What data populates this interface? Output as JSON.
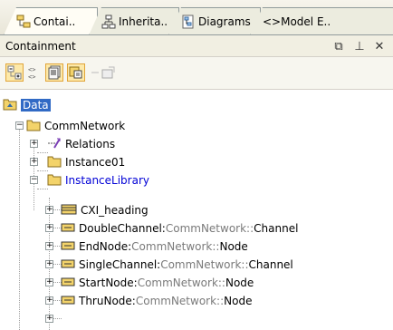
{
  "tabs": [
    {
      "label": "Contai..",
      "icon": "containment-tree-icon"
    },
    {
      "label": "Inherita..",
      "icon": "inheritance-tree-icon"
    },
    {
      "label": "Diagrams",
      "icon": "diagrams-icon"
    },
    {
      "label": "<>Model E..",
      "icon": "model-extensions-icon"
    }
  ],
  "panel": {
    "title": "Containment",
    "restore_icon": "restore-icon",
    "pin_icon": "pin-icon",
    "close_icon": "close-icon",
    "restore_glyph": "⧉",
    "pin_glyph": "⊥",
    "close_glyph": "✕"
  },
  "toolbar": {
    "buttons": [
      "collapse-all-icon",
      "expand-all-icon",
      "view-options-icon",
      "filter-icon",
      "new-element-icon"
    ]
  },
  "tree": {
    "data": {
      "label": "Data"
    },
    "comm_network": {
      "label": "CommNetwork"
    },
    "relations": {
      "label": "Relations"
    },
    "instance01": {
      "label": "Instance01"
    },
    "instance_library": {
      "label": "InstanceLibrary"
    },
    "cxi_heading": {
      "label": "CXI_heading"
    },
    "double_channel": {
      "label": "DoubleChannel",
      "sep": " : ",
      "type": "CommNetwork::",
      "type_name": "Channel"
    },
    "end_node": {
      "label": "EndNode",
      "sep": " : ",
      "type": "CommNetwork::",
      "type_name": "Node"
    },
    "single_channel": {
      "label": "SingleChannel",
      "sep": " : ",
      "type": "CommNetwork::",
      "type_name": "Channel"
    },
    "start_node": {
      "label": "StartNode",
      "sep": " : ",
      "type": "CommNetwork::",
      "type_name": "Node"
    },
    "thru_node": {
      "label": "ThruNode",
      "sep": " : ",
      "type": "CommNetwork::",
      "type_name": "Node"
    }
  },
  "colors": {
    "selection": "#316ac5",
    "link_text": "#0000d6",
    "package_folder": "#f3d36a"
  }
}
